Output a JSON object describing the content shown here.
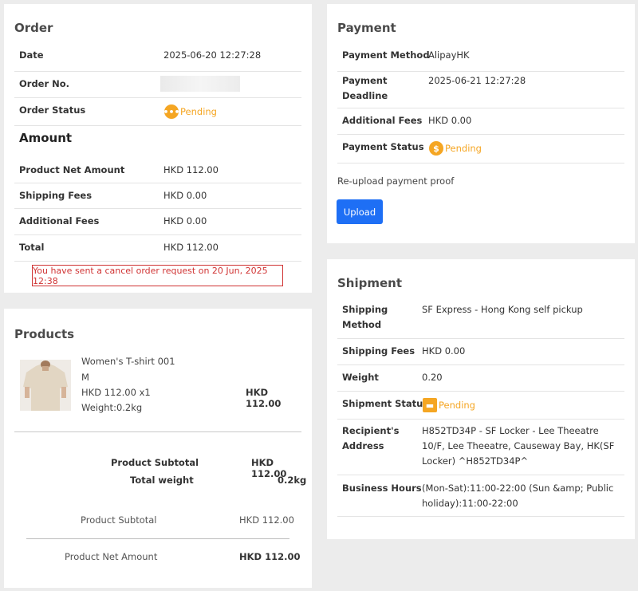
{
  "order": {
    "title": "Order",
    "date_label": "Date",
    "date_value": "2025-06-20 12:27:28",
    "order_no_label": "Order No.",
    "status_label": "Order Status",
    "status_value": "Pending",
    "amount_title": "Amount",
    "net_label": "Product Net Amount",
    "net_value": "HKD 112.00",
    "shipping_label": "Shipping Fees",
    "shipping_value": "HKD 0.00",
    "additional_label": "Additional Fees",
    "additional_value": "HKD 0.00",
    "total_label": "Total",
    "total_value": "HKD 112.00",
    "cancel_message": "You have sent a cancel order request on 20 Jun, 2025 12:38"
  },
  "payment": {
    "title": "Payment",
    "method_label": "Payment Method",
    "method_value": "AlipayHK",
    "deadline_label_1": "Payment",
    "deadline_label_2": "Deadline",
    "deadline_value": "2025-06-21 12:27:28",
    "fees_label": "Additional Fees",
    "fees_value": "HKD 0.00",
    "status_label": "Payment Status",
    "status_value": "Pending",
    "reupload_text": "Re-upload payment proof",
    "upload_label": "Upload"
  },
  "products": {
    "title": "Products",
    "item": {
      "name": "Women's T-shirt 001",
      "size": "M",
      "price_qty": "HKD 112.00 x1",
      "weight": "Weight:0.2kg",
      "line_total": "HKD 112.00"
    },
    "subtotal_label": "Product Subtotal",
    "subtotal_value": "HKD 112.00",
    "total_weight_label": "Total weight",
    "total_weight_value": "0.2kg",
    "subtotal2_label": "Product Subtotal",
    "subtotal2_value": "HKD 112.00",
    "net_label": "Product Net Amount",
    "net_value": "HKD 112.00"
  },
  "shipment": {
    "title": "Shipment",
    "method_label_1": "Shipping",
    "method_label_2": "Method",
    "method_value": "SF Express - Hong Kong self pickup",
    "fees_label": "Shipping Fees",
    "fees_value": "HKD 0.00",
    "weight_label": "Weight",
    "weight_value": "0.20",
    "status_label": "Shipment Status",
    "status_value": "Pending",
    "address_label_1": "Recipient's",
    "address_label_2": "Address",
    "address_line_1": "H852TD34P - SF Locker - Lee Theeatre",
    "address_line_2": "10/F, Lee Theeatre, Causeway Bay, HK(SF",
    "address_line_3": "Locker) ^H852TD34P^",
    "hours_label": "Business Hours",
    "hours_line_1": "(Mon-Sat):11:00-22:00 (Sun &amp; Public",
    "hours_line_2": "holiday):11:00-22:00"
  },
  "colors": {
    "accent": "#1e6ff5",
    "pending": "#f5a623",
    "error": "#d03434"
  }
}
